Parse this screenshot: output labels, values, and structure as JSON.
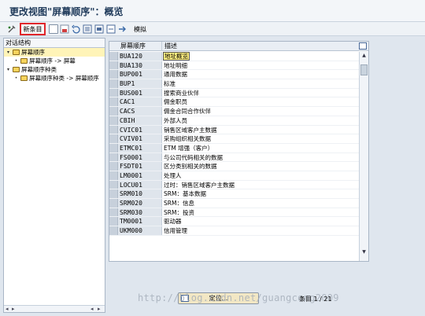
{
  "window": {
    "title": "更改视图\"屏幕顺序\"：概览"
  },
  "toolbar": {
    "new_entries_label": "新条目",
    "simulate_label": "模拟",
    "icons": [
      "toggle-edit-icon",
      "copy-icon",
      "delete-icon",
      "undo-icon",
      "select-all-icon",
      "select-block-icon",
      "deselect-all-icon",
      "transport-icon"
    ]
  },
  "left_pane": {
    "header": "对话结构",
    "tree": [
      {
        "label": "屏幕顺序",
        "level": 0,
        "expanded": true,
        "selected": true
      },
      {
        "label": "屏幕顺序 -> 屏幕",
        "level": 1,
        "expanded": false,
        "selected": false
      },
      {
        "label": "屏幕顺序种类",
        "level": 0,
        "expanded": true,
        "selected": false
      },
      {
        "label": "屏幕顺序种类 -> 屏幕顺序",
        "level": 1,
        "expanded": false,
        "selected": false
      }
    ]
  },
  "table": {
    "columns": [
      "屏幕顺序",
      "描述"
    ],
    "rows": [
      [
        "BUA120",
        "地址概览"
      ],
      [
        "BUA130",
        "地址明细"
      ],
      [
        "BUP001",
        "通用数据"
      ],
      [
        "BUP1",
        "标准"
      ],
      [
        "BUS001",
        "搜索商业伙伴"
      ],
      [
        "CAC1",
        "佣金职员"
      ],
      [
        "CACS",
        "佣金合同合作伙伴"
      ],
      [
        "CBIH",
        "外部人员"
      ],
      [
        "CVIC01",
        "销售区域客户主数据"
      ],
      [
        "CVIV01",
        "采购组织相关数据"
      ],
      [
        "ETMC01",
        "ETM 增强（客户）"
      ],
      [
        "FS0001",
        "与公司代码相关的数据"
      ],
      [
        "FSDT01",
        "区分类别相关的数据"
      ],
      [
        "LM0001",
        "处理人"
      ],
      [
        "LOCU01",
        "过时：销售区域客户主数据"
      ],
      [
        "SRM010",
        "SRM：基本数据"
      ],
      [
        "SRM020",
        "SRM：信息"
      ],
      [
        "SRM030",
        "SRM：投资"
      ],
      [
        "TM0001",
        "驱动器"
      ],
      [
        "UKM000",
        "信用管理"
      ]
    ],
    "focused_row": 0
  },
  "footer": {
    "locate_label": "定位...",
    "entry_label": "条目 1 / 21"
  },
  "watermark": "http://blog.csdn.net/guangcong2009"
}
